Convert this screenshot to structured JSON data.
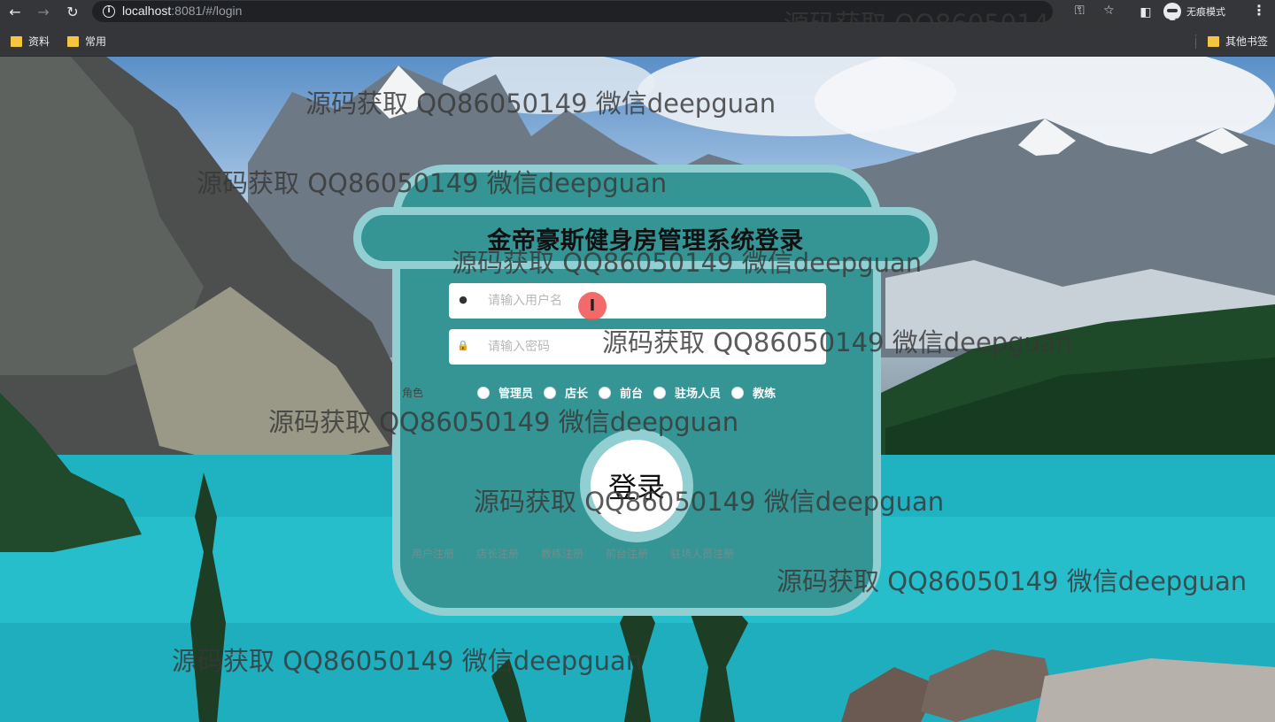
{
  "browser": {
    "url_host": "localhost",
    "url_rest": ":8081/#/login",
    "incognito_label": "无痕模式",
    "bookmarks": [
      "资料",
      "常用"
    ],
    "other_bookmarks": "其他书签"
  },
  "login": {
    "title": "金帝豪斯健身房管理系统登录",
    "username_placeholder": "请输入用户名",
    "password_placeholder": "请输入密码",
    "role_label": "角色",
    "roles": [
      "管理员",
      "店长",
      "前台",
      "驻场人员",
      "教练"
    ],
    "login_button": "登录",
    "register_links": [
      "用户注册",
      "店长注册",
      "教练注册",
      "前台注册",
      "驻场人员注册"
    ]
  },
  "watermark": "源码获取 QQ86050149 微信deepguan",
  "colors": {
    "card": "#359494",
    "card_border": "#92cfd2",
    "chrome": "#35363a"
  }
}
